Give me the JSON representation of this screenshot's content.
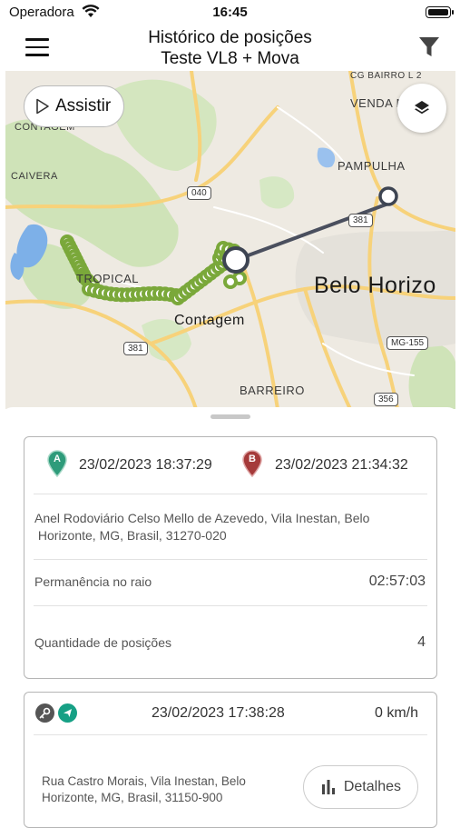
{
  "status_bar": {
    "carrier": "Operadora",
    "time": "16:45"
  },
  "nav": {
    "title_line1": "Histórico de posições",
    "title_line2": "Teste VL8 + Mova"
  },
  "map": {
    "play_label": "Assistir",
    "labels": {
      "contagem_top": "CONTAGEM",
      "caivera": "CAIVERA",
      "tropical": "TROPICAL",
      "contagem": "Contagem",
      "pampulha": "PAMPULHA",
      "venda_nova": "VENDA N",
      "cg_bairro": "CG BAIRRO L 2",
      "belo_horizonte": "Belo Horizo",
      "barreiro": "BARREIRO",
      "mg155": "MG-155"
    },
    "shields": {
      "r040": "040",
      "r381a": "381",
      "r381b": "381",
      "r356": "356",
      "r040b": "040"
    },
    "colors": {
      "track": "#7aa83a",
      "segment": "#4a4f5e",
      "marker": "#3d4452"
    }
  },
  "summary": {
    "start_letter": "A",
    "end_letter": "B",
    "start_datetime": "23/02/2023 18:37:29",
    "end_datetime": "23/02/2023 21:34:32",
    "address_line1": "Anel Rodoviário Celso Mello de Azevedo, Vila Inestan, Belo",
    "address_line2": " Horizonte, MG, Brasil, 31270-020",
    "permanence_label": "Permanência no raio",
    "permanence_value": "02:57:03",
    "positions_label": "Quantidade de posições",
    "positions_value": "4",
    "colors": {
      "start_pin": "#2e9b7a",
      "end_pin": "#a53a3a"
    }
  },
  "position": {
    "datetime": "23/02/2023 17:38:28",
    "speed": "0 km/h",
    "address_line1": "Rua Castro Morais, Vila Inestan, Belo",
    "address_line2": "Horizonte, MG, Brasil, 31150-900",
    "details_label": "Detalhes",
    "colors": {
      "ignition_icon": "#555555",
      "direction_icon": "#16a085"
    }
  }
}
